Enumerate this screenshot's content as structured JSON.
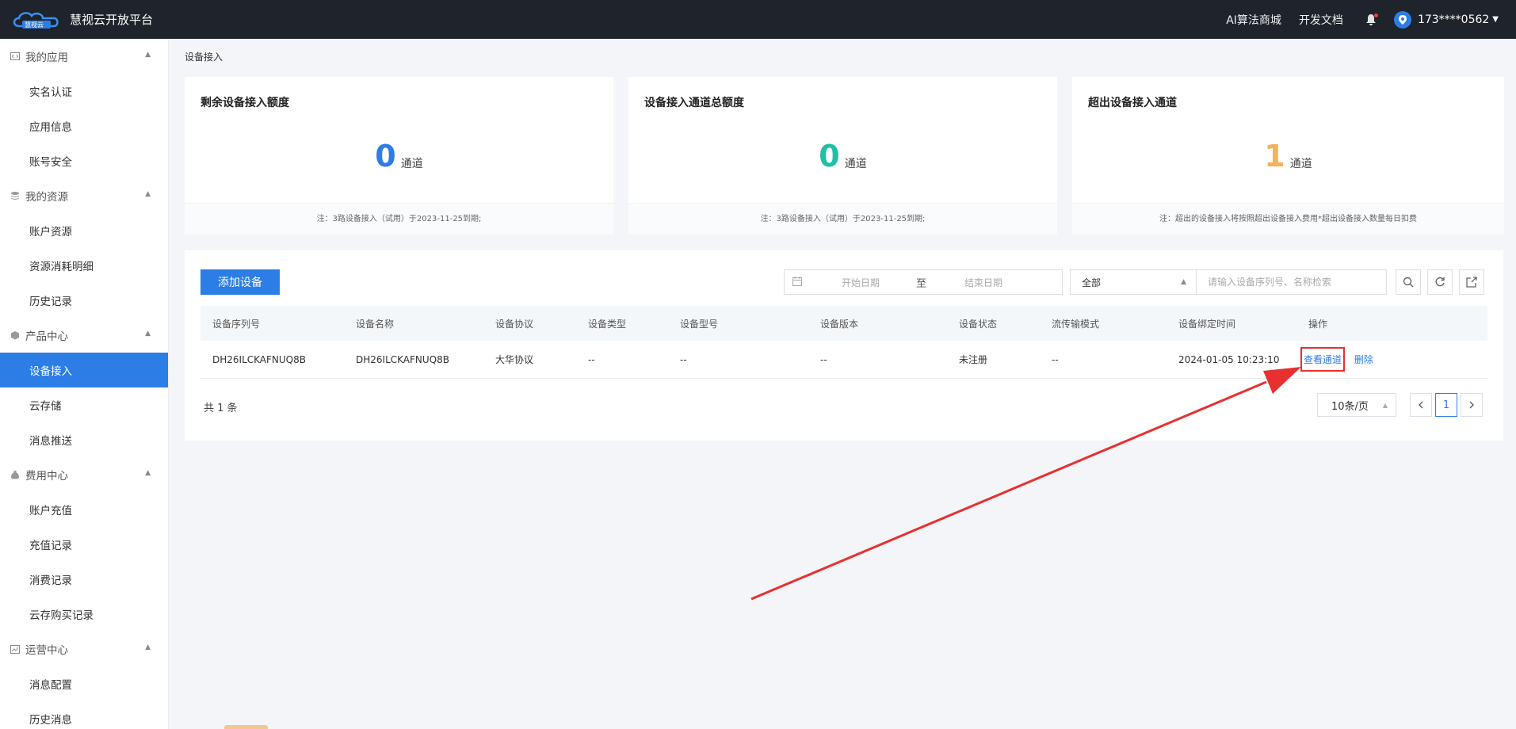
{
  "topbar": {
    "brand": "慧视云开放平台",
    "logo_text": "慧视云",
    "links": [
      "AI算法商城",
      "开发文档"
    ],
    "user": "173****0562"
  },
  "sidebar": {
    "groups": [
      {
        "label": "我的应用",
        "items": [
          "实名认证",
          "应用信息",
          "账号安全"
        ]
      },
      {
        "label": "我的资源",
        "items": [
          "账户资源",
          "资源消耗明细",
          "历史记录"
        ]
      },
      {
        "label": "产品中心",
        "items": [
          "设备接入",
          "云存储",
          "消息推送"
        ]
      },
      {
        "label": "费用中心",
        "items": [
          "账户充值",
          "充值记录",
          "消费记录",
          "云存购买记录"
        ]
      },
      {
        "label": "运营中心",
        "items": [
          "消息配置",
          "历史消息"
        ]
      }
    ],
    "active": "设备接入"
  },
  "breadcrumb": "设备接入",
  "cards": [
    {
      "title": "剩余设备接入额度",
      "value": "0",
      "unit": "通道",
      "color": "#2c7de6",
      "note": "注：3路设备接入（试用）于2023-11-25到期;"
    },
    {
      "title": "设备接入通道总额度",
      "value": "0",
      "unit": "通道",
      "color": "#1fc0a6",
      "note": "注：3路设备接入（试用）于2023-11-25到期;"
    },
    {
      "title": "超出设备接入通道",
      "value": "1",
      "unit": "通道",
      "color": "#f6b15a",
      "note": "注：超出的设备接入将按照超出设备接入费用*超出设备接入数量每日扣费"
    }
  ],
  "toolbar": {
    "add_button": "添加设备",
    "start_placeholder": "开始日期",
    "range_sep": "至",
    "end_placeholder": "结束日期",
    "filter_value": "全部",
    "search_placeholder": "请输入设备序列号、名称检索"
  },
  "table": {
    "headers": [
      "设备序列号",
      "设备名称",
      "设备协议",
      "设备类型",
      "设备型号",
      "设备版本",
      "设备状态",
      "流传输模式",
      "设备绑定时间",
      "操作"
    ],
    "rows": [
      {
        "cells": [
          "DH26ILCKAFNUQ8B",
          "DH26ILCKAFNUQ8B",
          "大华协议",
          "--",
          "--",
          "--",
          "未注册",
          "--",
          "2024-01-05 10:23:10"
        ],
        "view": "查看通道",
        "del": "删除"
      }
    ]
  },
  "pagination": {
    "total": "共 1 条",
    "page_size": "10条/页",
    "current": "1"
  },
  "colors": {
    "accent": "#2c7de6",
    "highlight": "#e8302f"
  }
}
